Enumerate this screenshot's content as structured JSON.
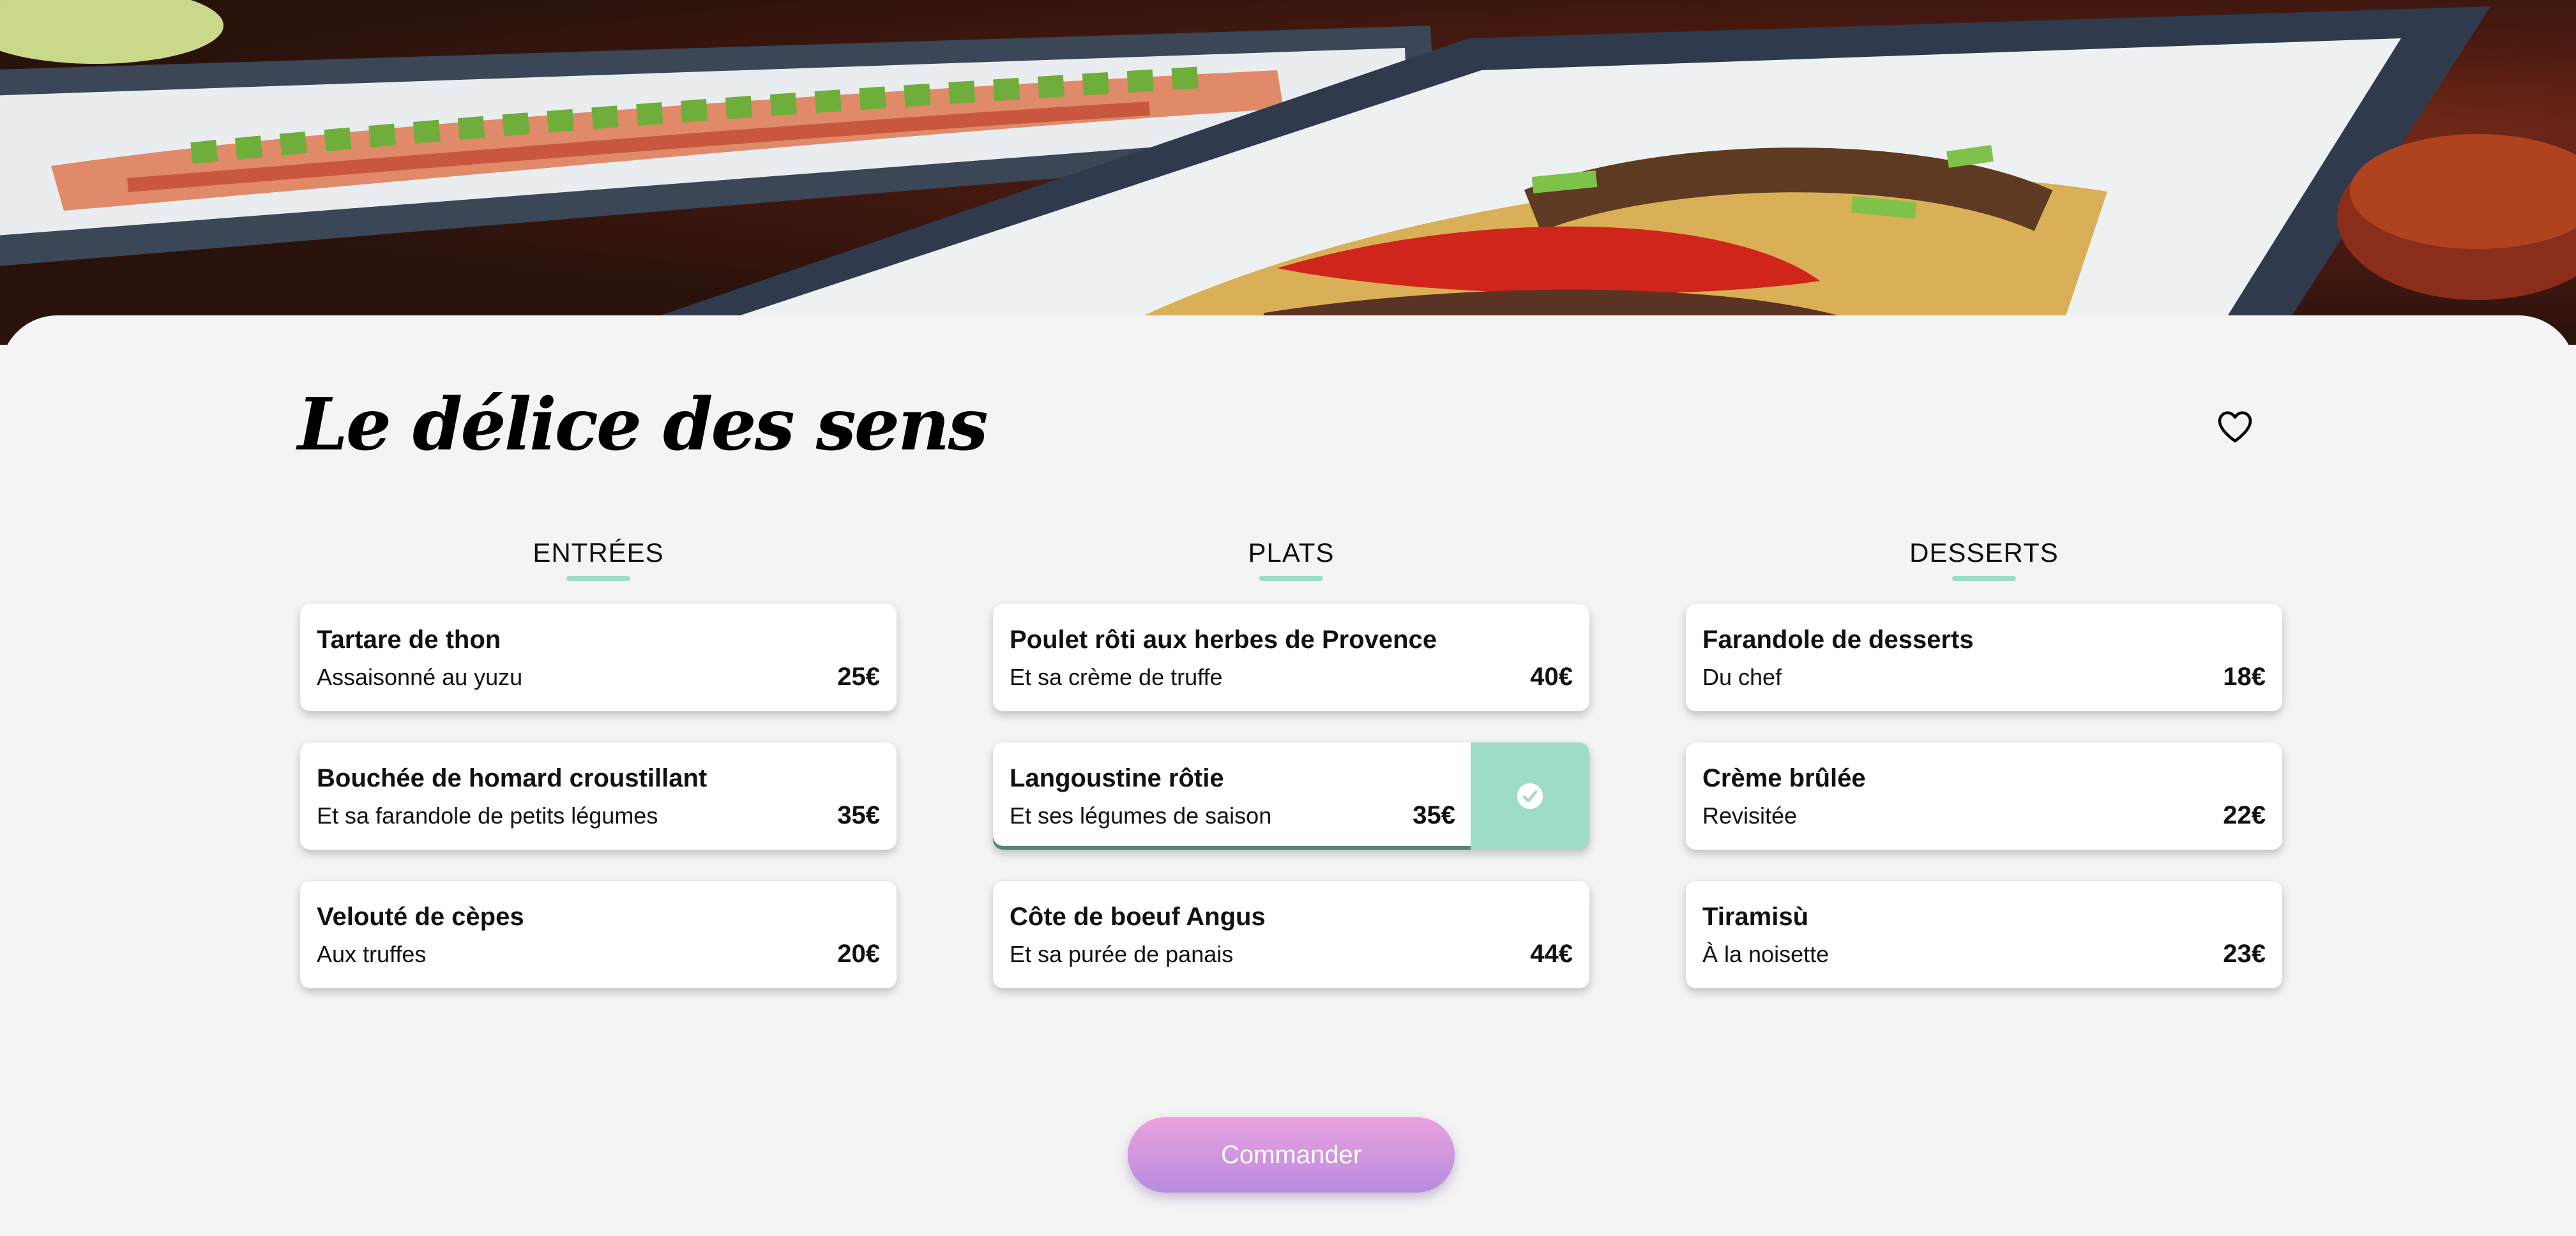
{
  "header": {
    "title": "Le délice des sens",
    "favorite_icon": "heart-icon",
    "hero_image": "food-photo"
  },
  "menu": {
    "accent_color": "#9fdcc5",
    "columns": [
      {
        "heading": "ENTRÉES",
        "items": [
          {
            "name": "Tartare de thon",
            "description": "Assaisonné au yuzu",
            "price": "25€",
            "selected": false
          },
          {
            "name": "Bouchée de homard croustillant",
            "description": "Et sa farandole de petits légumes",
            "price": "35€",
            "selected": false
          },
          {
            "name": "Velouté de cèpes",
            "description": "Aux truffes",
            "price": "20€",
            "selected": false
          }
        ]
      },
      {
        "heading": "PLATS",
        "items": [
          {
            "name": "Poulet rôti aux herbes de Provence",
            "description": "Et sa crème de truffe",
            "price": "40€",
            "selected": false
          },
          {
            "name": "Langoustine rôtie",
            "description": "Et ses légumes de saison",
            "price": "35€",
            "selected": true
          },
          {
            "name": "Côte de boeuf Angus",
            "description": "Et sa purée de panais",
            "price": "44€",
            "selected": false
          }
        ]
      },
      {
        "heading": "DESSERTS",
        "items": [
          {
            "name": "Farandole de desserts",
            "description": "Du chef",
            "price": "18€",
            "selected": false
          },
          {
            "name": "Crème brûlée",
            "description": "Revisitée",
            "price": "22€",
            "selected": false
          },
          {
            "name": "Tiramisù",
            "description": "À la noisette",
            "price": "23€",
            "selected": false
          }
        ]
      }
    ]
  },
  "actions": {
    "order_label": "Commander",
    "order_gradient": [
      "#eaa1de",
      "#b88ce0"
    ]
  }
}
